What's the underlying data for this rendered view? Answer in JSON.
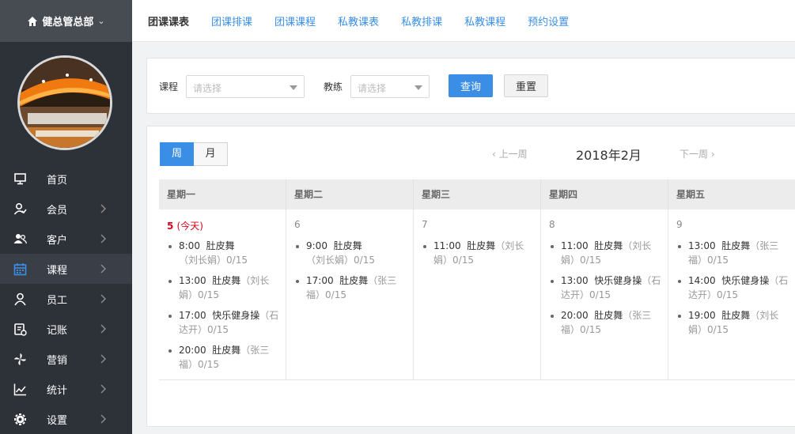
{
  "sidebar": {
    "brand": "健总管总部",
    "menu": [
      {
        "label": "首页",
        "icon": "monitor-icon",
        "arrow": false
      },
      {
        "label": "会员",
        "icon": "member-icon",
        "arrow": true
      },
      {
        "label": "客户",
        "icon": "customers-icon",
        "arrow": true
      },
      {
        "label": "课程",
        "icon": "calendar-icon",
        "arrow": true,
        "active": true
      },
      {
        "label": "员工",
        "icon": "user-icon",
        "arrow": true
      },
      {
        "label": "记账",
        "icon": "ledger-icon",
        "arrow": true
      },
      {
        "label": "营销",
        "icon": "pinwheel-icon",
        "arrow": true
      },
      {
        "label": "统计",
        "icon": "line-chart-icon",
        "arrow": true
      },
      {
        "label": "设置",
        "icon": "gear-icon",
        "arrow": true
      }
    ]
  },
  "topnav": {
    "tabs": [
      "团课课表",
      "团课排课",
      "团课课程",
      "私教课表",
      "私教排课",
      "私教课程",
      "预约设置"
    ],
    "current": "团课课表"
  },
  "filter": {
    "course_label": "课程",
    "course_placeholder": "请选择",
    "coach_label": "教练",
    "coach_placeholder": "请选择",
    "query_button": "查询",
    "reset_button": "重置"
  },
  "calendar": {
    "view_week": "周",
    "view_month": "月",
    "active_view": "周",
    "prev_label": "上一周",
    "next_label": "下一周",
    "month_title": "2018年2月",
    "days": [
      {
        "weekday": "星期一",
        "date": "5",
        "today_label": "(今天)",
        "events": [
          {
            "time": "8:00",
            "name": "肚皮舞",
            "coach": "（刘长娟）",
            "count": "0/15"
          },
          {
            "time": "13:00",
            "name": "肚皮舞",
            "coach": "（刘长娟）",
            "count": "0/15"
          },
          {
            "time": "17:00",
            "name": "快乐健身操",
            "coach": "（石达开）",
            "count": "0/15"
          },
          {
            "time": "20:00",
            "name": "肚皮舞",
            "coach": "（张三福）",
            "count": "0/15"
          }
        ]
      },
      {
        "weekday": "星期二",
        "date": "6",
        "events": [
          {
            "time": "9:00",
            "name": "肚皮舞",
            "coach": "（刘长娟）",
            "count": "0/15"
          },
          {
            "time": "17:00",
            "name": "肚皮舞",
            "coach": "（张三福）",
            "count": "0/15"
          }
        ]
      },
      {
        "weekday": "星期三",
        "date": "7",
        "events": [
          {
            "time": "11:00",
            "name": "肚皮舞",
            "coach": "（刘长娟）",
            "count": "0/15"
          }
        ]
      },
      {
        "weekday": "星期四",
        "date": "8",
        "events": [
          {
            "time": "11:00",
            "name": "肚皮舞",
            "coach": "（刘长娟）",
            "count": "0/15"
          },
          {
            "time": "13:00",
            "name": "快乐健身操",
            "coach": "（石达开）",
            "count": "0/15"
          },
          {
            "time": "20:00",
            "name": "肚皮舞",
            "coach": "（张三福）",
            "count": "0/15"
          }
        ]
      },
      {
        "weekday": "星期五",
        "date": "9",
        "events": [
          {
            "time": "13:00",
            "name": "肚皮舞",
            "coach": "（张三福）",
            "count": "0/15"
          },
          {
            "time": "14:00",
            "name": "快乐健身操",
            "coach": "（石达开）",
            "count": "0/15"
          },
          {
            "time": "19:00",
            "name": "肚皮舞",
            "coach": "（刘长娟）",
            "count": "0/15"
          }
        ]
      }
    ]
  },
  "colors": {
    "sidebar_bg": "#2d3138",
    "brand_bg": "#474c53",
    "accent": "#3a8ee6",
    "today": "#d0021b",
    "active_menu_icon": "#3a8ee6"
  }
}
